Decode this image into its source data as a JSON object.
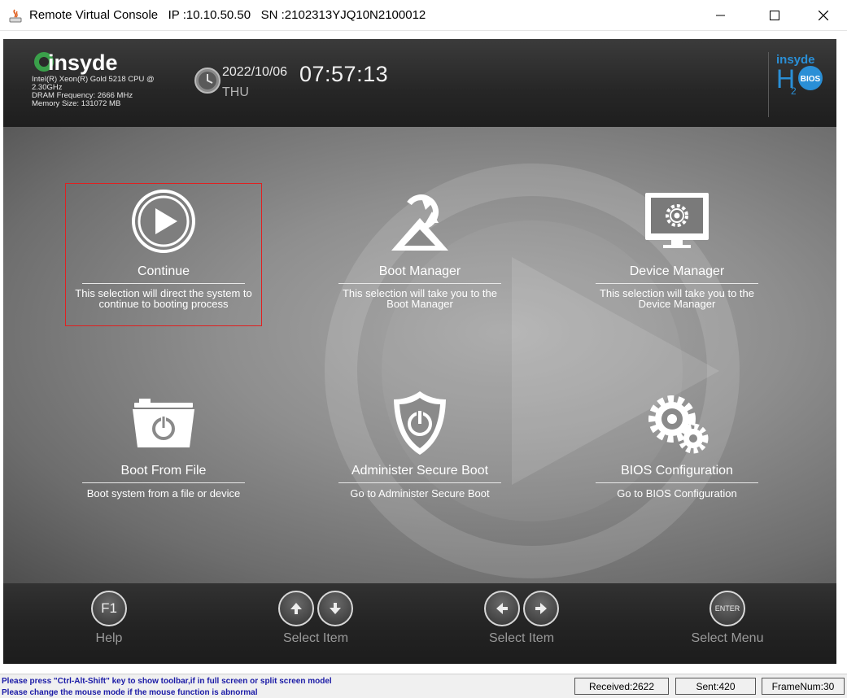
{
  "window": {
    "title": "Remote Virtual Console   IP :10.10.50.50   SN :2102313YJQ10N2100012"
  },
  "header": {
    "brand": "insyde",
    "sysinfo": [
      "Intel(R) Xeon(R) Gold 5218 CPU @",
      "2.30GHz",
      "DRAM Frequency: 2666 MHz",
      "Memory Size: 131072 MB"
    ],
    "date": "2022/10/06",
    "day": "THU",
    "time": "07:57:13",
    "h2_brand": "insyde",
    "h2_bios": "BIOS"
  },
  "menu": [
    {
      "label": "Continue",
      "desc": "This selection will direct the system to continue to booting process",
      "icon": "play-circle-icon",
      "selected": true
    },
    {
      "label": "Boot Manager",
      "desc": "This selection will take you to the Boot Manager",
      "icon": "boot-manager-icon",
      "selected": false
    },
    {
      "label": "Device Manager",
      "desc": "This selection will take you to the Device Manager",
      "icon": "monitor-gear-icon",
      "selected": false
    },
    {
      "label": "Boot From File",
      "desc": "Boot system from a file or device",
      "icon": "folder-power-icon",
      "selected": false
    },
    {
      "label": "Administer Secure Boot",
      "desc": "Go to Administer Secure Boot",
      "icon": "shield-power-icon",
      "selected": false
    },
    {
      "label": "BIOS Configuration",
      "desc": "Go to BIOS Configuration",
      "icon": "gears-icon",
      "selected": false
    }
  ],
  "footer": {
    "help": {
      "key": "F1",
      "label": "Help"
    },
    "select_item_ud": {
      "label": "Select Item"
    },
    "select_item_lr": {
      "label": "Select Item"
    },
    "select_menu": {
      "key": "ENTER",
      "label": "Select Menu"
    }
  },
  "statusbar": {
    "msg1": "Please press \"Ctrl-Alt-Shift\" key to show toolbar,if in full screen or split screen model",
    "msg2": "Please change the mouse mode if the mouse function is abnormal",
    "received": "Received:2622",
    "sent": "Sent:420",
    "framenum": "FrameNum:30"
  },
  "colors": {
    "selection_outline": "#e02020",
    "status_text": "#1a1aa6",
    "logo_green": "#3aa04a",
    "h2_blue": "#2a8fd6"
  }
}
